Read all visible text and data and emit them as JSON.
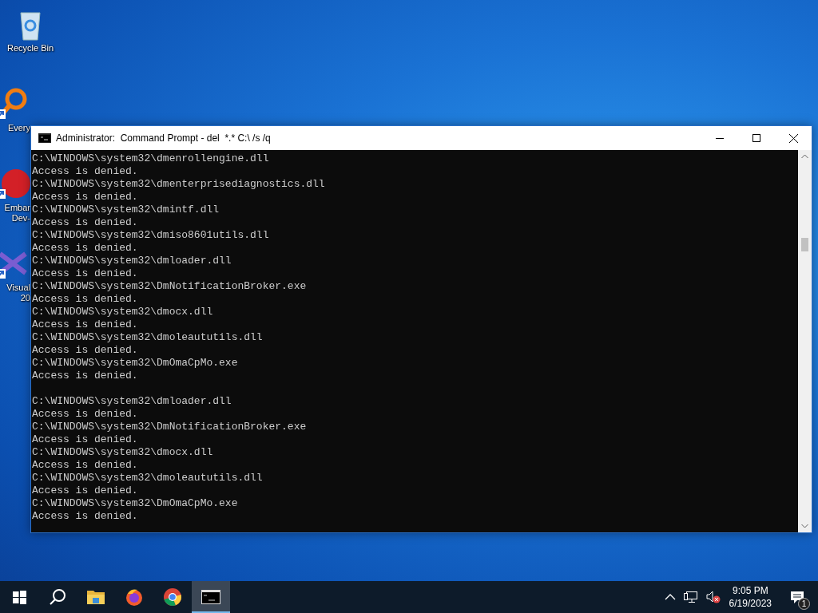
{
  "desktop_icons": [
    {
      "kind": "recycle",
      "label": "Recycle Bin",
      "shortcut": false
    },
    {
      "kind": "search",
      "label": "Every",
      "shortcut": true
    },
    {
      "kind": "embarcadero",
      "label": "Embar\nDev-",
      "shortcut": true
    },
    {
      "kind": "visual",
      "label": "Visual\n20",
      "shortcut": true
    }
  ],
  "window": {
    "title": "Administrator:  Command Prompt - del  *.* C:\\ /s /q",
    "console_blocks": [
      [
        "C:\\WINDOWS\\system32\\dmenrollengine.dll",
        "Access is denied.",
        "C:\\WINDOWS\\system32\\dmenterprisediagnostics.dll",
        "Access is denied.",
        "C:\\WINDOWS\\system32\\dmintf.dll",
        "Access is denied.",
        "C:\\WINDOWS\\system32\\dmiso8601utils.dll",
        "Access is denied.",
        "C:\\WINDOWS\\system32\\dmloader.dll",
        "Access is denied.",
        "C:\\WINDOWS\\system32\\DmNotificationBroker.exe",
        "Access is denied.",
        "C:\\WINDOWS\\system32\\dmocx.dll",
        "Access is denied.",
        "C:\\WINDOWS\\system32\\dmoleaututils.dll",
        "Access is denied.",
        "C:\\WINDOWS\\system32\\DmOmaCpMo.exe",
        "Access is denied."
      ],
      [
        "C:\\WINDOWS\\system32\\dmloader.dll",
        "Access is denied.",
        "C:\\WINDOWS\\system32\\DmNotificationBroker.exe",
        "Access is denied.",
        "C:\\WINDOWS\\system32\\dmocx.dll",
        "Access is denied.",
        "C:\\WINDOWS\\system32\\dmoleaututils.dll",
        "Access is denied.",
        "C:\\WINDOWS\\system32\\DmOmaCpMo.exe",
        "Access is denied."
      ]
    ]
  },
  "taskbar": {
    "apps": [
      {
        "kind": "explorer",
        "selected": false
      },
      {
        "kind": "firefox",
        "selected": false
      },
      {
        "kind": "chrome",
        "selected": false
      },
      {
        "kind": "cmd",
        "selected": true
      }
    ],
    "clock_time": "9:05 PM",
    "clock_date": "6/19/2023",
    "notification_count": "1",
    "volume_muted": true
  }
}
